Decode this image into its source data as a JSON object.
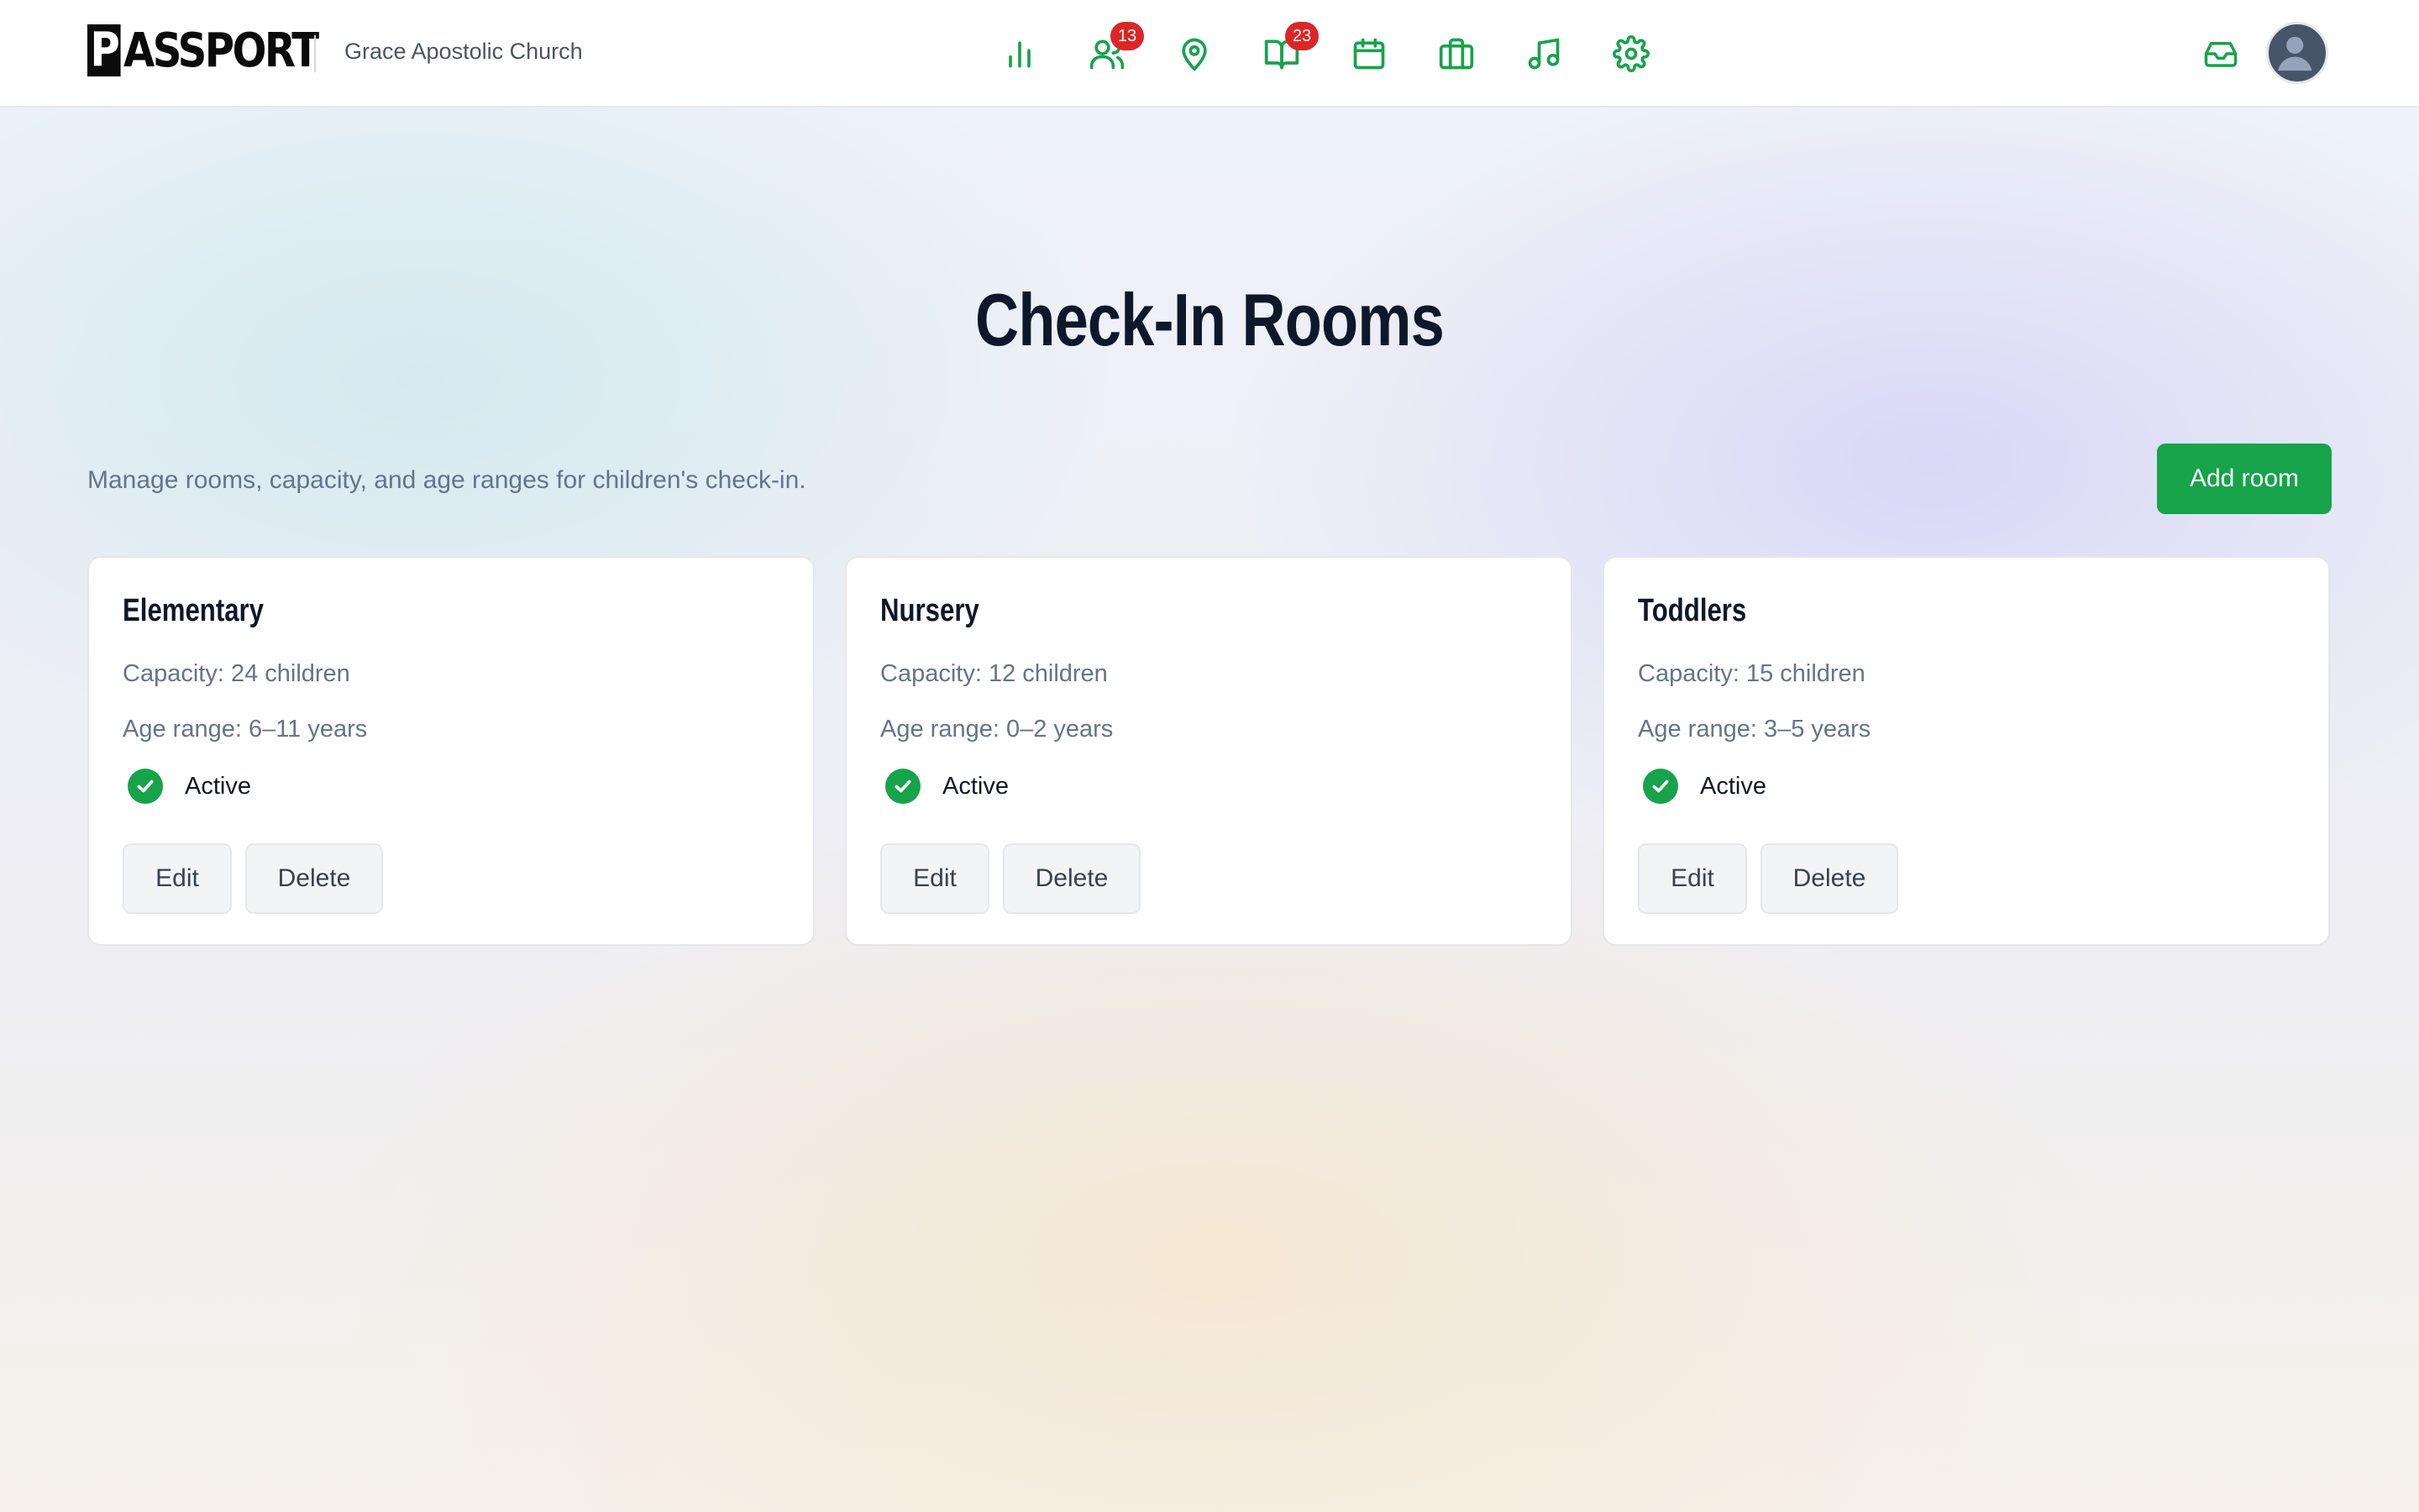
{
  "header": {
    "logo_initial": "P",
    "logo_rest": "ASSPORT",
    "org_name": "Grace Apostolic Church",
    "nav": [
      {
        "icon": "bar-chart-icon",
        "badge": null
      },
      {
        "icon": "users-icon",
        "badge": "13"
      },
      {
        "icon": "map-pin-icon",
        "badge": null
      },
      {
        "icon": "book-open-icon",
        "badge": "23"
      },
      {
        "icon": "calendar-icon",
        "badge": null
      },
      {
        "icon": "briefcase-icon",
        "badge": null
      },
      {
        "icon": "music-icon",
        "badge": null
      },
      {
        "icon": "settings-icon",
        "badge": null
      }
    ],
    "inbox_icon": "inbox-icon",
    "avatar_icon": "user-avatar-icon"
  },
  "main": {
    "title": "Check-In Rooms",
    "subtitle": "Manage rooms, capacity, and age ranges for children's check-in.",
    "add_button": "Add room"
  },
  "rooms": [
    {
      "name": "Elementary",
      "capacity": "Capacity: 24 children",
      "age_range": "Age range: 6–11 years",
      "status": "Active",
      "edit": "Edit",
      "delete": "Delete"
    },
    {
      "name": "Nursery",
      "capacity": "Capacity: 12 children",
      "age_range": "Age range: 0–2 years",
      "status": "Active",
      "edit": "Edit",
      "delete": "Delete"
    },
    {
      "name": "Toddlers",
      "capacity": "Capacity: 15 children",
      "age_range": "Age range: 3–5 years",
      "status": "Active",
      "edit": "Edit",
      "delete": "Delete"
    }
  ],
  "colors": {
    "accent": "#16a34a",
    "badge": "#dc2626",
    "title": "#0f172a",
    "muted": "#64748b"
  }
}
